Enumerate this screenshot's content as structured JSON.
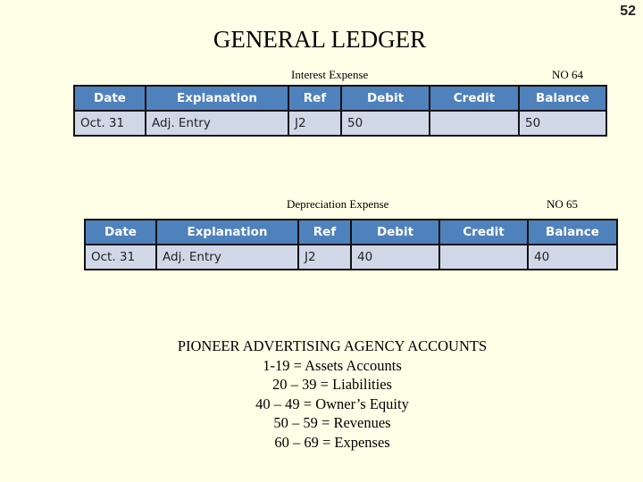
{
  "page_number": "52",
  "title": "GENERAL LEDGER",
  "columns": [
    "Date",
    "Explanation",
    "Ref",
    "Debit",
    "Credit",
    "Balance"
  ],
  "accounts": [
    {
      "name": "Interest Expense",
      "number": "NO 64",
      "rows": [
        {
          "date": "Oct. 31",
          "explanation": "Adj. Entry",
          "ref": "J2",
          "debit": "50",
          "credit": "",
          "balance": "50"
        }
      ]
    },
    {
      "name": "Depreciation Expense",
      "number": "NO 65",
      "rows": [
        {
          "date": "Oct. 31",
          "explanation": "Adj. Entry",
          "ref": "J2",
          "debit": "40",
          "credit": "",
          "balance": "40"
        }
      ]
    }
  ],
  "legend": {
    "heading": "PIONEER ADVERTISING AGENCY ACCOUNTS",
    "lines": [
      "1-19 = Assets Accounts",
      "20 – 39 = Liabilities",
      "40 – 49 = Owner’s Equity",
      "50 – 59 = Revenues",
      "60 – 69 = Expenses"
    ]
  },
  "colors": {
    "background": "#ffffe7",
    "header_fill": "#4f81bd",
    "row_fill": "#d0d8e8"
  }
}
